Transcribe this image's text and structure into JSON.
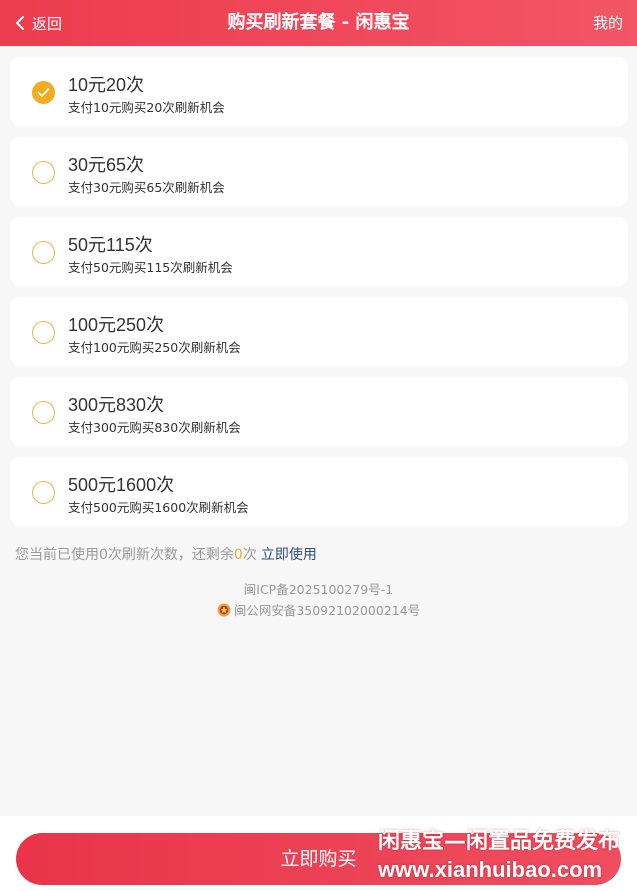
{
  "header": {
    "back_label": "返回",
    "title": "购买刷新套餐 - 闲惠宝",
    "mine_label": "我的"
  },
  "packages": [
    {
      "title": "10元20次",
      "desc": "支付10元购买20次刷新机会",
      "selected": true
    },
    {
      "title": "30元65次",
      "desc": "支付30元购买65次刷新机会",
      "selected": false
    },
    {
      "title": "50元115次",
      "desc": "支付50元购买115次刷新机会",
      "selected": false
    },
    {
      "title": "100元250次",
      "desc": "支付100元购买250次刷新机会",
      "selected": false
    },
    {
      "title": "300元830次",
      "desc": "支付300元购买830次刷新机会",
      "selected": false
    },
    {
      "title": "500元1600次",
      "desc": "支付500元购买1600次刷新机会",
      "selected": false
    }
  ],
  "usage": {
    "prefix": "您当前已使用",
    "used": "0",
    "middle": "次刷新次数，还剩余",
    "remaining": "0",
    "suffix": "次",
    "use_now_label": "立即使用"
  },
  "footer_info": {
    "icp": "闽ICP备2025100279号-1",
    "police": "闽公网安备35092102000214号"
  },
  "buy_button_label": "立即购买",
  "watermark": {
    "line1": "闲惠宝—闲置品免费发布",
    "line2": "www.xianhuibao.com"
  },
  "colors": {
    "header": "#ec3c4e",
    "accent": "#f3ac1e",
    "link": "#2f4f7a"
  }
}
